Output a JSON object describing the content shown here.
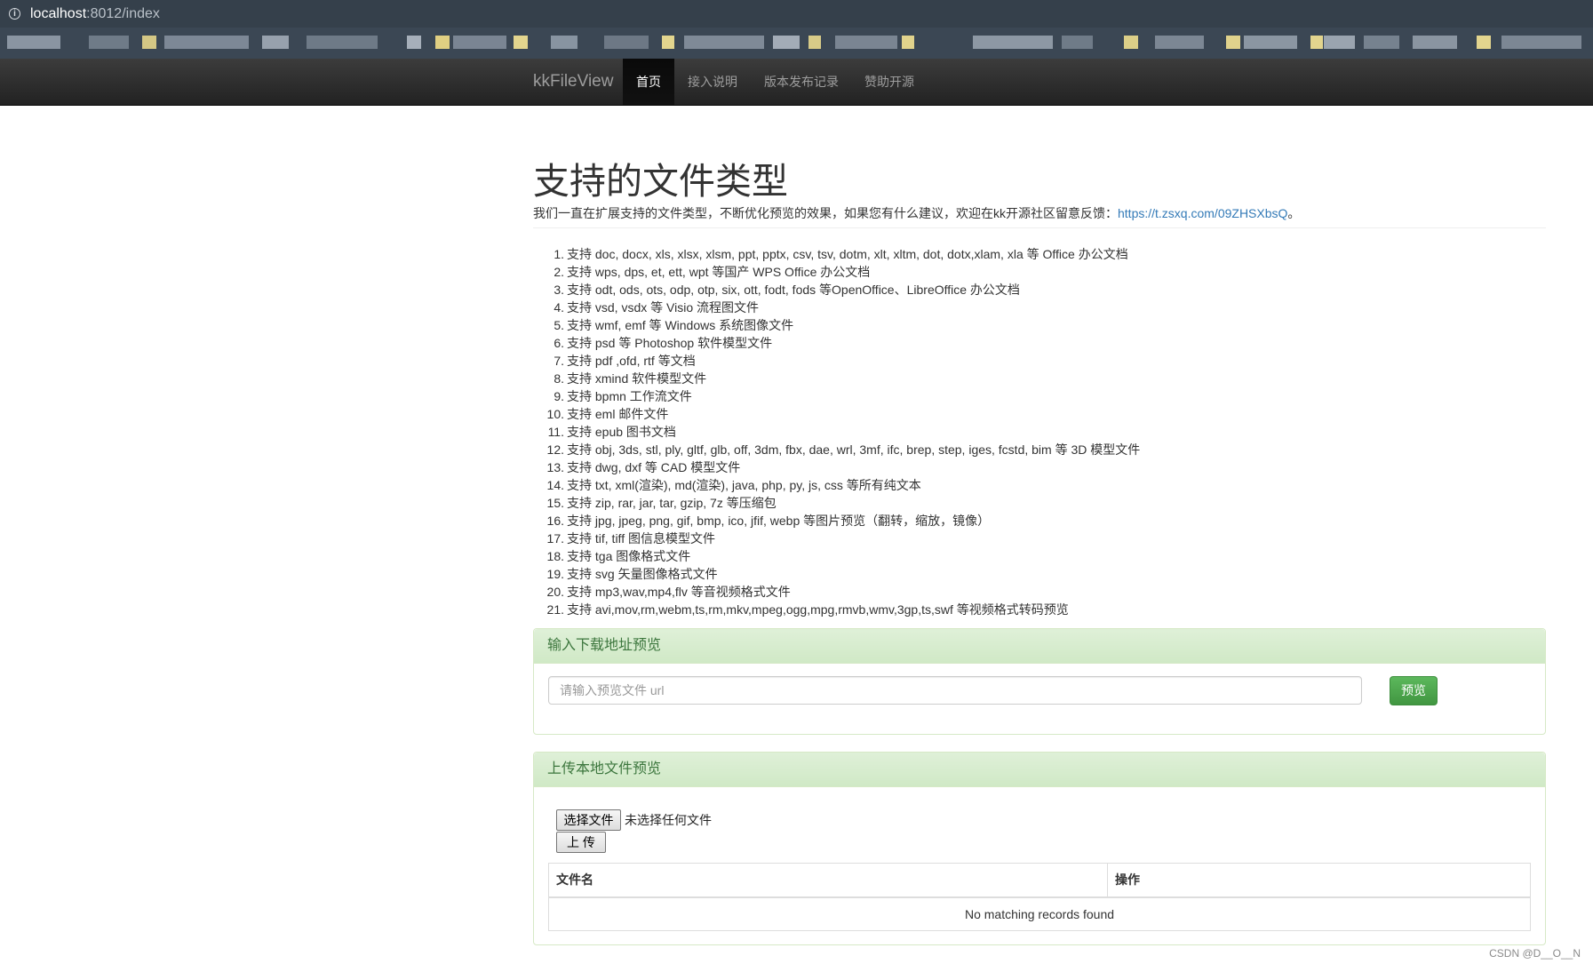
{
  "browser": {
    "url_host": "localhost",
    "url_path": ":8012/index"
  },
  "navbar": {
    "brand": "kkFileView",
    "items": [
      {
        "label": "首页",
        "active": true
      },
      {
        "label": "接入说明",
        "active": false
      },
      {
        "label": "版本发布记录",
        "active": false
      },
      {
        "label": "赞助开源",
        "active": false
      }
    ]
  },
  "main": {
    "title": "支持的文件类型",
    "intro_text": "我们一直在扩展支持的文件类型，不断优化预览的效果，如果您有什么建议，欢迎在kk开源社区留意反馈：",
    "intro_link": "https://t.zsxq.com/09ZHSXbsQ",
    "intro_end": "。",
    "file_types": [
      {
        "num": "1.",
        "text": "支持 doc, docx, xls, xlsx, xlsm, ppt, pptx, csv, tsv, dotm, xlt, xltm, dot, dotx,xlam, xla 等 Office 办公文档"
      },
      {
        "num": "2.",
        "text": "支持 wps, dps, et, ett, wpt 等国产 WPS Office 办公文档"
      },
      {
        "num": "3.",
        "text": "支持 odt, ods, ots, odp, otp, six, ott, fodt, fods 等OpenOffice、LibreOffice 办公文档"
      },
      {
        "num": "4.",
        "text": "支持 vsd, vsdx 等 Visio 流程图文件"
      },
      {
        "num": "5.",
        "text": "支持 wmf, emf 等 Windows 系统图像文件"
      },
      {
        "num": "6.",
        "text": "支持 psd 等 Photoshop 软件模型文件"
      },
      {
        "num": "7.",
        "text": "支持 pdf ,ofd, rtf 等文档"
      },
      {
        "num": "8.",
        "text": "支持 xmind 软件模型文件"
      },
      {
        "num": "9.",
        "text": "支持 bpmn 工作流文件"
      },
      {
        "num": "10.",
        "text": "支持 eml 邮件文件"
      },
      {
        "num": "11.",
        "text": "支持 epub 图书文档"
      },
      {
        "num": "12.",
        "text": "支持 obj, 3ds, stl, ply, gltf, glb, off, 3dm, fbx, dae, wrl, 3mf, ifc, brep, step, iges, fcstd, bim 等 3D 模型文件"
      },
      {
        "num": "13.",
        "text": "支持 dwg, dxf 等 CAD 模型文件"
      },
      {
        "num": "14.",
        "text": "支持 txt, xml(渲染), md(渲染), java, php, py, js, css 等所有纯文本"
      },
      {
        "num": "15.",
        "text": "支持 zip, rar, jar, tar, gzip, 7z 等压缩包"
      },
      {
        "num": "16.",
        "text": "支持 jpg, jpeg, png, gif, bmp, ico, jfif, webp 等图片预览（翻转，缩放，镜像）"
      },
      {
        "num": "17.",
        "text": "支持 tif, tiff 图信息模型文件"
      },
      {
        "num": "18.",
        "text": "支持 tga 图像格式文件"
      },
      {
        "num": "19.",
        "text": "支持 svg 矢量图像格式文件"
      },
      {
        "num": "20.",
        "text": "支持 mp3,wav,mp4,flv 等音视频格式文件"
      },
      {
        "num": "21.",
        "text": "支持 avi,mov,rm,webm,ts,rm,mkv,mpeg,ogg,mpg,rmvb,wmv,3gp,ts,swf 等视频格式转码预览"
      }
    ]
  },
  "url_panel": {
    "heading": "输入下载地址预览",
    "input_placeholder": "请输入预览文件 url",
    "input_value": "",
    "button": "预览"
  },
  "upload_panel": {
    "heading": "上传本地文件预览",
    "choose_button": "选择文件",
    "file_status": "未选择任何文件",
    "upload_button": "上 传",
    "table": {
      "columns": [
        "文件名",
        "操作"
      ],
      "empty_text": "No matching records found"
    }
  },
  "watermark": "CSDN @D__O__N",
  "colors": {
    "navbar": "#222222",
    "link": "#337ab7",
    "panel_heading": "#dff0d8",
    "panel_text": "#3c763d",
    "success_button": "#5cb85c"
  }
}
